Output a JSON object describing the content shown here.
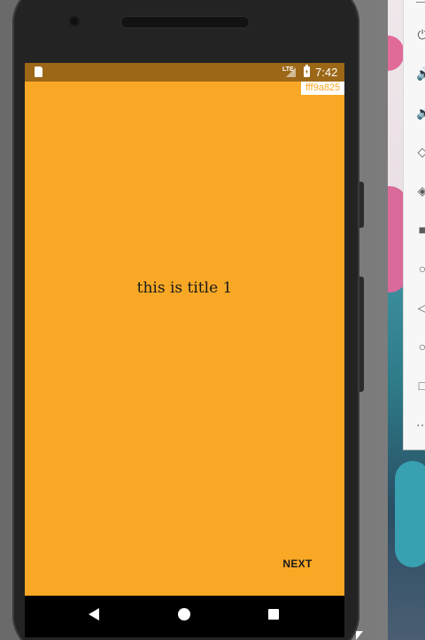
{
  "status_bar": {
    "time": "7:42",
    "network_type": "LTE",
    "icons": [
      "sd-card-icon",
      "signal-icon",
      "battery-charging-icon"
    ]
  },
  "app": {
    "color_label": "fff9a825",
    "title": "this is title 1",
    "next_label": "NEXT",
    "background_color": "#f9a825",
    "status_bar_color": "#9c6716"
  },
  "nav_bar": {
    "icons": [
      "back-icon",
      "home-icon",
      "recents-icon"
    ]
  },
  "emulator_toolbar": {
    "icons": [
      "power-icon",
      "volume-up-icon",
      "volume-down-icon",
      "rotate-left-icon",
      "rotate-right-icon",
      "camera-icon",
      "zoom-icon",
      "back-icon",
      "home-icon",
      "overview-icon",
      "more-icon"
    ]
  }
}
